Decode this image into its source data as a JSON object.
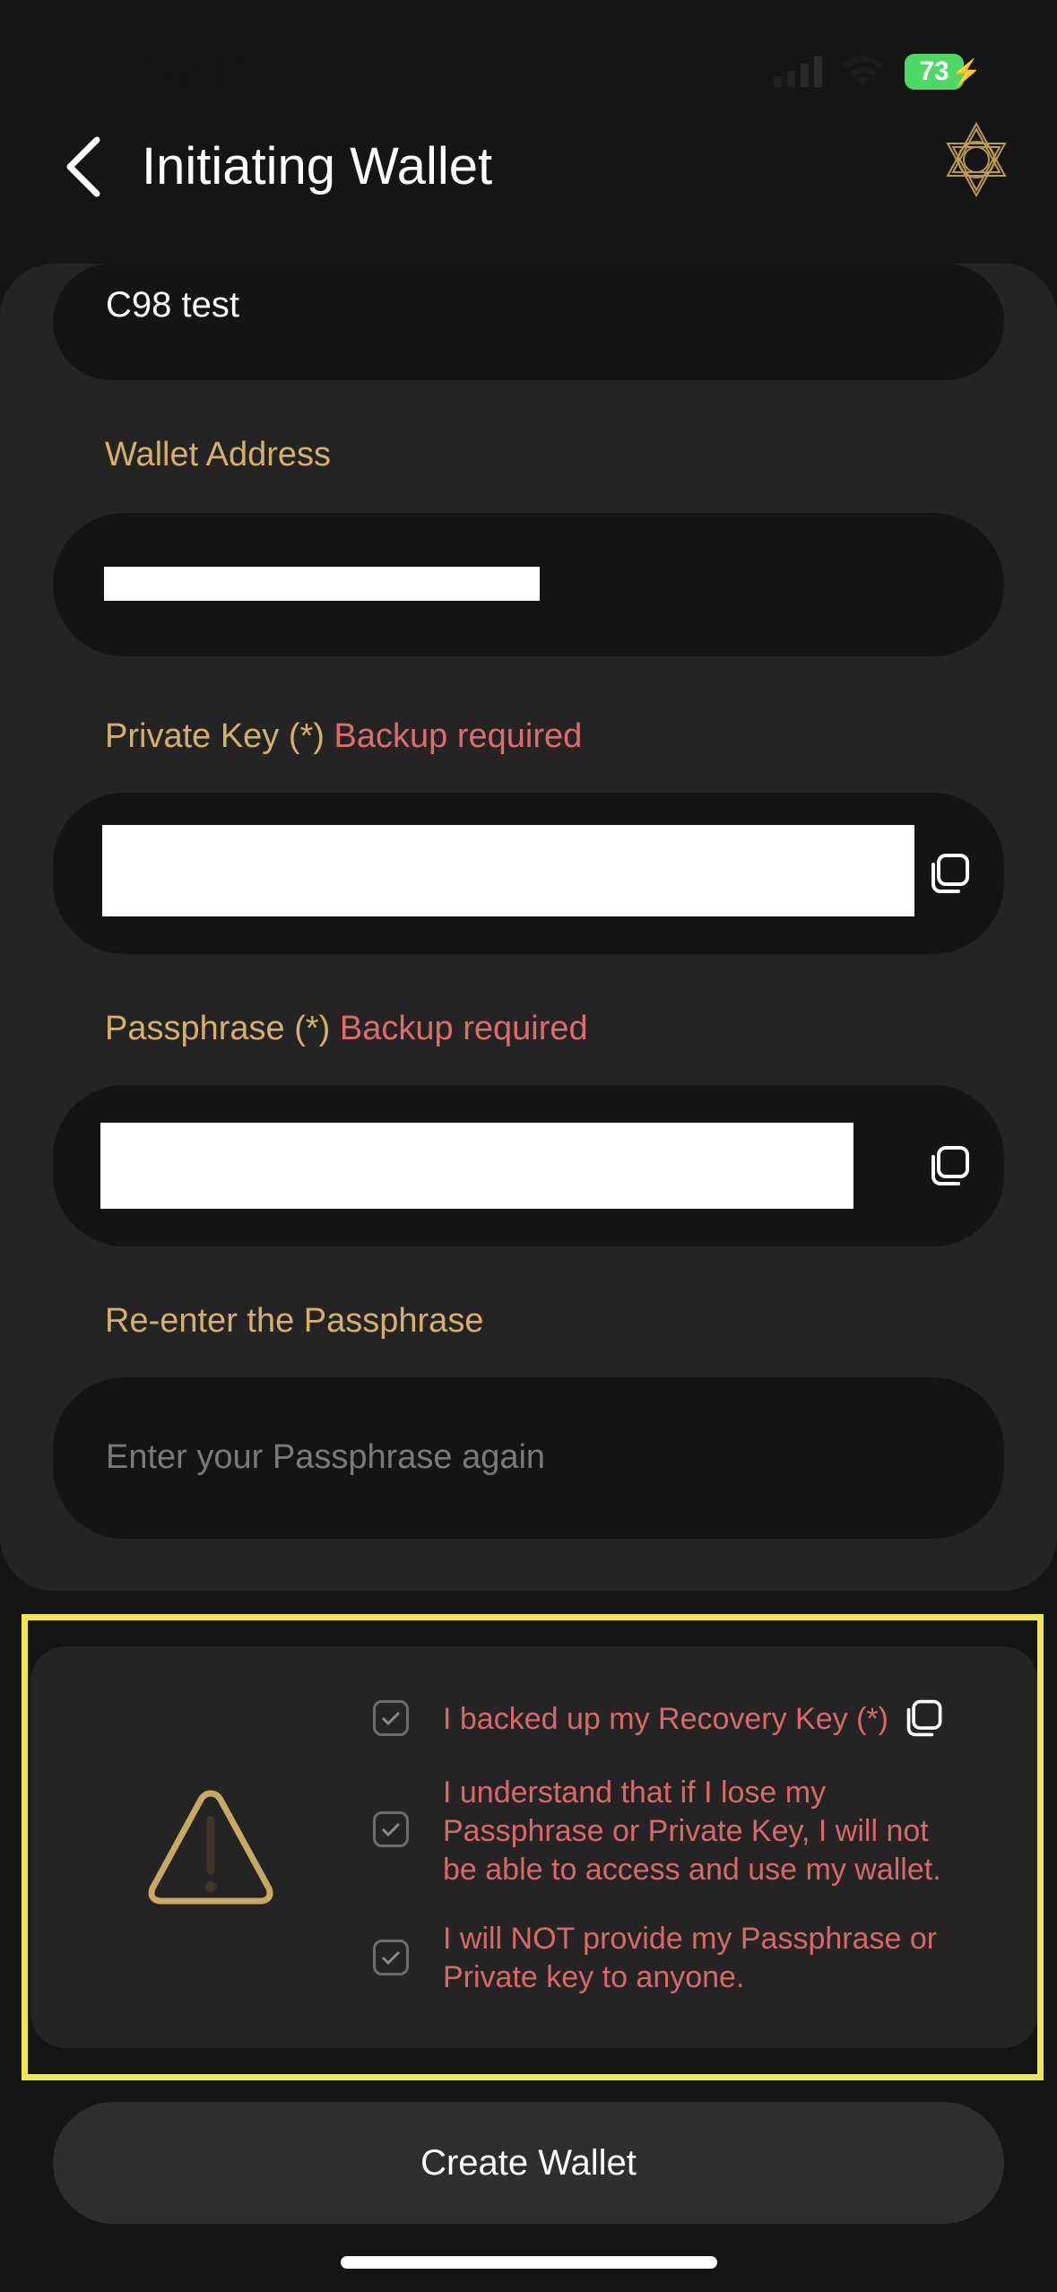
{
  "status_bar": {
    "time": "14:11",
    "battery": "73"
  },
  "header": {
    "title": "Initiating Wallet"
  },
  "form": {
    "wallet_name_value": "C98 test",
    "wallet_address_label": "Wallet Address",
    "private_key_label": "Private Key (*)",
    "private_key_required": "Backup required",
    "passphrase_label": "Passphrase (*)",
    "passphrase_required": "Backup required",
    "reenter_label": "Re-enter the Passphrase",
    "reenter_placeholder": "Enter your Passphrase again"
  },
  "warnings": {
    "items": [
      {
        "text": "I backed up my Recovery Key (*)"
      },
      {
        "text": "I understand that if I lose my Passphrase or Private Key, I will not be able to access and use my wallet."
      },
      {
        "text": "I will NOT provide my Passphrase or Private key to anyone."
      }
    ]
  },
  "create_button_label": "Create Wallet",
  "colors": {
    "background": "#151515",
    "card": "#242424",
    "field": "#141414",
    "gold_label": "#d4b06a",
    "warning_red": "#e06b6b",
    "highlight_yellow": "#f2e84a",
    "battery_green": "#4cd964"
  }
}
